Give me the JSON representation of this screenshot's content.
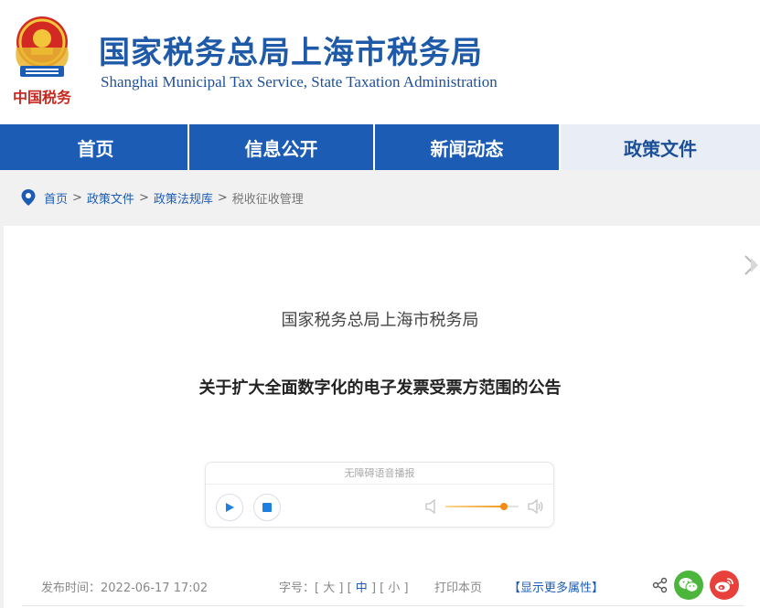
{
  "header": {
    "title": "国家税务总局上海市税务局",
    "subtitle": "Shanghai Municipal Tax Service, State Taxation Administration",
    "emblem_caption": "中国税务"
  },
  "nav": {
    "items": [
      {
        "label": "首页",
        "active": false
      },
      {
        "label": "信息公开",
        "active": false
      },
      {
        "label": "新闻动态",
        "active": false
      },
      {
        "label": "政策文件",
        "active": true
      }
    ]
  },
  "breadcrumb": {
    "items": [
      "首页",
      "政策文件",
      "政策法规库"
    ],
    "current": "税收征收管理",
    "separator": ">"
  },
  "document": {
    "org": "国家税务总局上海市税务局",
    "title": "关于扩大全面数字化的电子发票受票方范围的公告"
  },
  "player": {
    "label": "无障碍语音播报",
    "volume": 0.8
  },
  "meta": {
    "publish_label": "发布时间：",
    "publish_date": "2022-06-17 17:02",
    "font_size_label": "字号：",
    "font_large": "大",
    "font_medium": "中",
    "font_small": "小",
    "print_label": "打印本页",
    "more_label": "【显示更多属性】"
  },
  "colors": {
    "brand_blue": "#1d5cb4",
    "accent_orange": "#f28a14",
    "wechat_green": "#4cb53b",
    "weibo_red": "#e8403a"
  }
}
